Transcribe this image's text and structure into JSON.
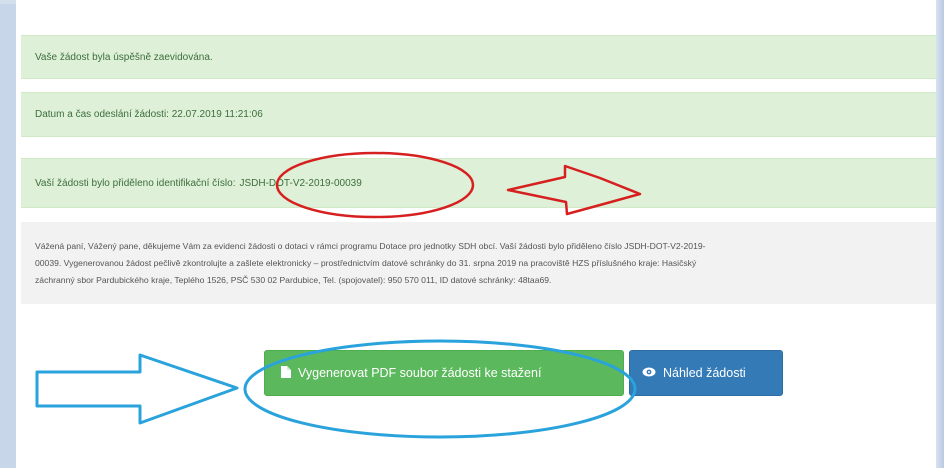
{
  "alerts": {
    "success": "Vaše žádost byla úspěšně zaevidována.",
    "datetime": "Datum a čas odeslání žádosti: 22.07.2019 11:21:06",
    "id_label": "Vaší žádosti bylo přiděleno identifikační číslo:",
    "id_value": "JSDH-DOT-V2-2019-00039"
  },
  "info": {
    "line1": "Vážená paní, Vážený pane, děkujeme Vám za evidenci žádosti o dotaci v rámci programu Dotace pro jednotky SDH obcí. Vaší žádosti bylo přiděleno číslo JSDH-DOT-V2-2019-",
    "line2": "00039. Vygenerovanou žádost pečlivě zkontrolujte a zašlete elektronicky – prostřednictvím datové schránky do 31. srpna 2019 na pracoviště HZS příslušného kraje: Hasičský",
    "line3": "záchranný sbor Pardubického kraje, Teplého 1526, PSČ 530 02 Pardubice, Tel. (spojovatel): 950 570 011, ID datové schránky: 48taa69."
  },
  "buttons": {
    "generate_pdf": "Vygenerovat PDF soubor žádosti ke stažení",
    "preview": "Náhled žádosti"
  },
  "icons": {
    "pdf": "file-icon",
    "preview": "eye-icon"
  },
  "colors": {
    "success_bg": "#dff0d8",
    "success_text": "#3c6e3c",
    "btn_green": "#5cb85c",
    "btn_blue": "#337ab7",
    "annotation_red": "#d62020",
    "annotation_blue": "#2aa3dc"
  }
}
